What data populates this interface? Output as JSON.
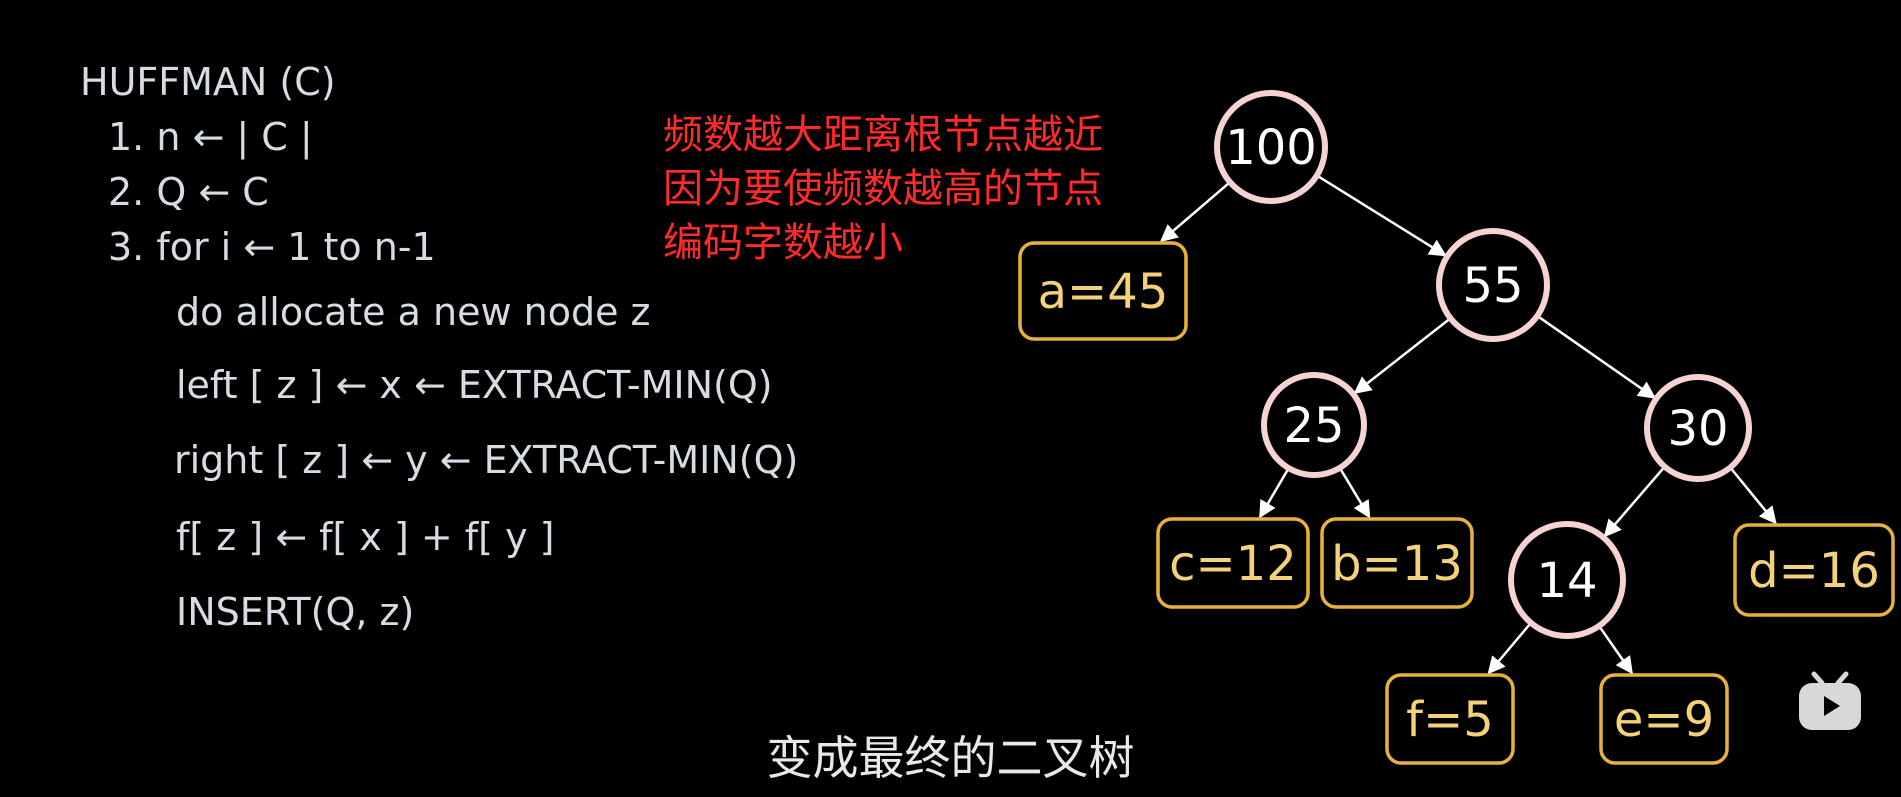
{
  "code": {
    "lines": [
      "HUFFMAN (C)",
      "1. n ← | C |",
      "2. Q ← C",
      "3. for i ← 1 to n-1",
      "do allocate a new node z",
      "left [ z ] ← x ← EXTRACT-MIN(Q)",
      "right [ z ] ← y ← EXTRACT-MIN(Q)",
      "f[ z ] ← f[ x ] + f[ y ]",
      "INSERT(Q, z)"
    ]
  },
  "note": {
    "lines": [
      "频数越大距离根节点越近",
      "因为要使频数越高的节点",
      "编码字数越小"
    ],
    "color": "#ff2a2a"
  },
  "tree": {
    "nodes": [
      {
        "id": "n100",
        "label": "100",
        "kind": "internal"
      },
      {
        "id": "a",
        "label": "a=45",
        "kind": "leaf"
      },
      {
        "id": "n55",
        "label": "55",
        "kind": "internal"
      },
      {
        "id": "n25",
        "label": "25",
        "kind": "internal"
      },
      {
        "id": "n30",
        "label": "30",
        "kind": "internal"
      },
      {
        "id": "c",
        "label": "c=12",
        "kind": "leaf"
      },
      {
        "id": "b",
        "label": "b=13",
        "kind": "leaf"
      },
      {
        "id": "n14",
        "label": "14",
        "kind": "internal"
      },
      {
        "id": "d",
        "label": "d=16",
        "kind": "leaf"
      },
      {
        "id": "f",
        "label": "f=5",
        "kind": "leaf"
      },
      {
        "id": "e",
        "label": "e=9",
        "kind": "leaf"
      }
    ],
    "edges": [
      [
        "n100",
        "a"
      ],
      [
        "n100",
        "n55"
      ],
      [
        "n55",
        "n25"
      ],
      [
        "n55",
        "n30"
      ],
      [
        "n25",
        "c"
      ],
      [
        "n25",
        "b"
      ],
      [
        "n30",
        "n14"
      ],
      [
        "n30",
        "d"
      ],
      [
        "n14",
        "f"
      ],
      [
        "n14",
        "e"
      ]
    ],
    "colors": {
      "circle_stroke": "#f6d3d3",
      "leaf_stroke": "#e8b23a",
      "leaf_text": "#f4d27a",
      "internal_text": "#ffffff",
      "edge": "#ffffff"
    }
  },
  "subtitle": "变成最终的二叉树",
  "logo_icon": "bilibili-tv-icon"
}
